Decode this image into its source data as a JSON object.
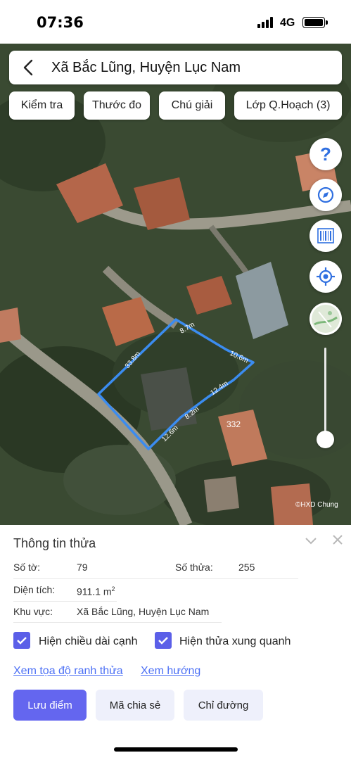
{
  "status": {
    "time": "07:36",
    "network": "4G"
  },
  "search": {
    "location": "Xã Bắc Lũng, Huyện Lục Nam"
  },
  "toolbar": {
    "check": "Kiểm tra",
    "measure": "Thước đo",
    "legend": "Chú giải",
    "layers": "Lớp Q.Hoạch (3)"
  },
  "map": {
    "edges": [
      "8.7m",
      "10.6m",
      "12.4m",
      "8.2m",
      "12.6m",
      "33.8m"
    ],
    "neighbor_label": "332",
    "copyright": "©HXD Chung",
    "parcel_color": "#3b8cf0"
  },
  "info": {
    "title": "Thông tin thửa",
    "sheet_label": "Số tờ:",
    "sheet_value": "79",
    "parcel_label": "Số thửa:",
    "parcel_value": "255",
    "area_label": "Diện tích:",
    "area_value": "911.1 m",
    "area_unit_sup": "2",
    "region_label": "Khu vực:",
    "region_value": "Xã Bắc Lũng, Huyện Lục Nam",
    "show_edges": "Hiện chiều dài cạnh",
    "show_neighbors": "Hiện thửa xung quanh",
    "view_coords": "Xem tọa độ ranh thửa",
    "view_direction": "Xem hướng",
    "save_point": "Lưu điểm",
    "share_code": "Mã chia sẻ",
    "directions": "Chỉ đường"
  },
  "colors": {
    "accent": "#6466ef",
    "link": "#4b6ff5",
    "fab_icon": "#2f6fe0"
  }
}
